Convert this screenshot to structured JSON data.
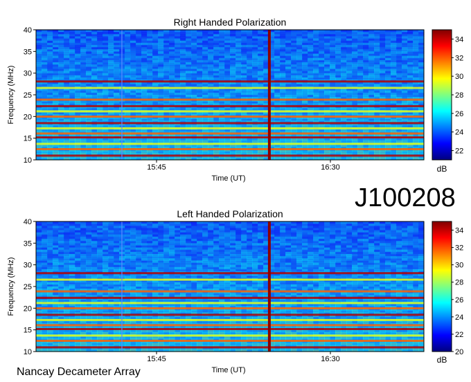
{
  "observation_id": "J100208",
  "instrument": "Nancay Decameter Array",
  "chart_data": [
    {
      "type": "heatmap",
      "title": "Right Handed Polarization",
      "xlabel": "Time (UT)",
      "ylabel": "Frequency (MHz)",
      "x_ticks": [
        "15:45",
        "16:30"
      ],
      "y_ticks": [
        10,
        15,
        20,
        25,
        30,
        35,
        40
      ],
      "ylim": [
        10,
        40
      ],
      "colorbar": {
        "label": "dB",
        "ticks": [
          22,
          24,
          26,
          28,
          30,
          32,
          34
        ],
        "range": [
          21,
          35
        ],
        "colors": [
          "#00007f",
          "#0000ff",
          "#007fff",
          "#00ffff",
          "#7fff7f",
          "#ffff00",
          "#ff7f00",
          "#ff0000",
          "#7f0000"
        ]
      }
    },
    {
      "type": "heatmap",
      "title": "Left Handed Polarization",
      "xlabel": "Time (UT)",
      "ylabel": "Frequency (MHz)",
      "x_ticks": [
        "15:45",
        "16:30"
      ],
      "y_ticks": [
        10,
        15,
        20,
        25,
        30,
        35,
        40
      ],
      "ylim": [
        10,
        40
      ],
      "colorbar": {
        "label": "dB",
        "ticks": [
          20,
          22,
          24,
          26,
          28,
          30,
          32,
          34
        ],
        "range": [
          20,
          35
        ],
        "colors": [
          "#00007f",
          "#0000ff",
          "#007fff",
          "#00ffff",
          "#7fff7f",
          "#ffff00",
          "#ff7f00",
          "#ff0000",
          "#7f0000"
        ]
      }
    }
  ]
}
